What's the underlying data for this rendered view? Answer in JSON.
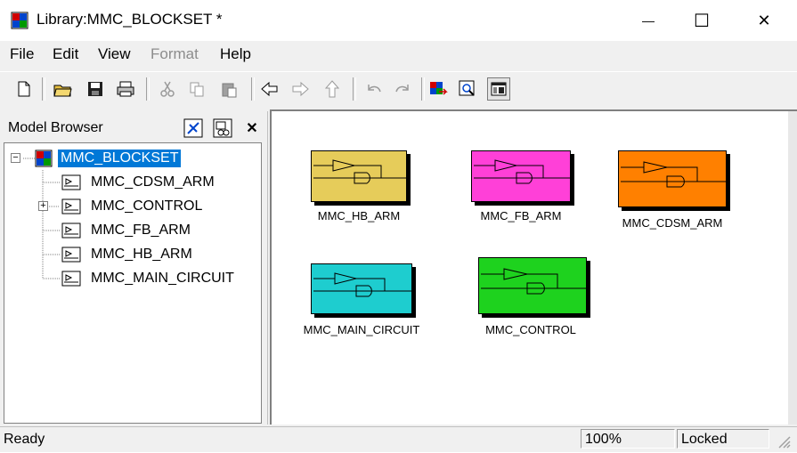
{
  "window": {
    "title": "Library:MMC_BLOCKSET *",
    "minimize_glyph": "—",
    "maximize_glyph": "☐",
    "close_glyph": "✕"
  },
  "menu": [
    "File",
    "Edit",
    "View",
    "Format",
    "Help"
  ],
  "menu_disabled": [
    "Format"
  ],
  "model_browser": {
    "title": "Model Browser",
    "root": "MMC_BLOCKSET",
    "children": [
      "MMC_CDSM_ARM",
      "MMC_CONTROL",
      "MMC_FB_ARM",
      "MMC_HB_ARM",
      "MMC_MAIN_CIRCUIT"
    ],
    "expandable_child": "MMC_CONTROL"
  },
  "blocks": [
    {
      "name": "MMC_HB_ARM",
      "color": "#e6cc5a"
    },
    {
      "name": "MMC_FB_ARM",
      "color": "#ff40d8"
    },
    {
      "name": "MMC_CDSM_ARM",
      "color": "#ff8000"
    },
    {
      "name": "MMC_MAIN_CIRCUIT",
      "color": "#1ecdcf"
    },
    {
      "name": "MMC_CONTROL",
      "color": "#1ed21e"
    }
  ],
  "status": {
    "text": "Ready",
    "zoom": "100%",
    "lock": "Locked"
  }
}
